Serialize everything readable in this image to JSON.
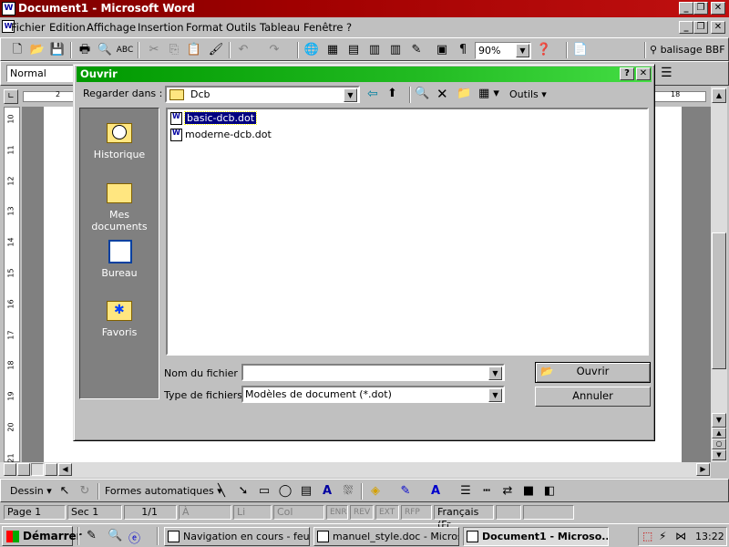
{
  "window": {
    "title": "Document1 - Microsoft Word"
  },
  "menu": [
    "Fichier",
    "Edition",
    "Affichage",
    "Insertion",
    "Format",
    "Outils",
    "Tableau",
    "Fenêtre",
    "?"
  ],
  "toolbar": {
    "zoom": "90%",
    "balisage_label": "balisage BBF"
  },
  "format_toolbar": {
    "style": "Normal"
  },
  "dialog": {
    "title": "Ouvrir",
    "lookin_label": "Regarder dans :",
    "lookin_value": "Dcb",
    "tools_label": "Outils",
    "places": [
      "Historique",
      "Mes documents",
      "Bureau",
      "Favoris"
    ],
    "files": [
      "basic-dcb.dot",
      "moderne-dcb.dot"
    ],
    "filename_label": "Nom du fichier :",
    "filename_value": "",
    "filetype_label": "Type de fichiers :",
    "filetype_value": "Modèles de document (*.dot)",
    "open_button": "Ouvrir",
    "cancel_button": "Annuler"
  },
  "ruler": {
    "top_marks": [
      "2",
      "18"
    ],
    "left_marks": [
      "10",
      "11",
      "12",
      "13",
      "14",
      "15",
      "16",
      "17",
      "18",
      "19",
      "20",
      "21"
    ]
  },
  "draw_toolbar": {
    "dessin": "Dessin",
    "formes": "Formes automatiques"
  },
  "status": {
    "page": "Page 1",
    "sec": "Sec 1",
    "pages": "1/1",
    "at": "À",
    "li": "Li",
    "col": "Col",
    "enr": "ENR",
    "rev": "REV",
    "ext": "EXT",
    "rfp": "RFP",
    "lang": "Français (Fr"
  },
  "taskbar": {
    "start": "Démarrer",
    "tasks": [
      "Navigation en cours - feuill...",
      "manuel_style.doc - Micros...",
      "Document1 - Microso..."
    ],
    "clock": "13:22"
  },
  "colors": {
    "title_active": "#a00000",
    "dialog_title": "#22bb22",
    "selection": "#000080"
  }
}
